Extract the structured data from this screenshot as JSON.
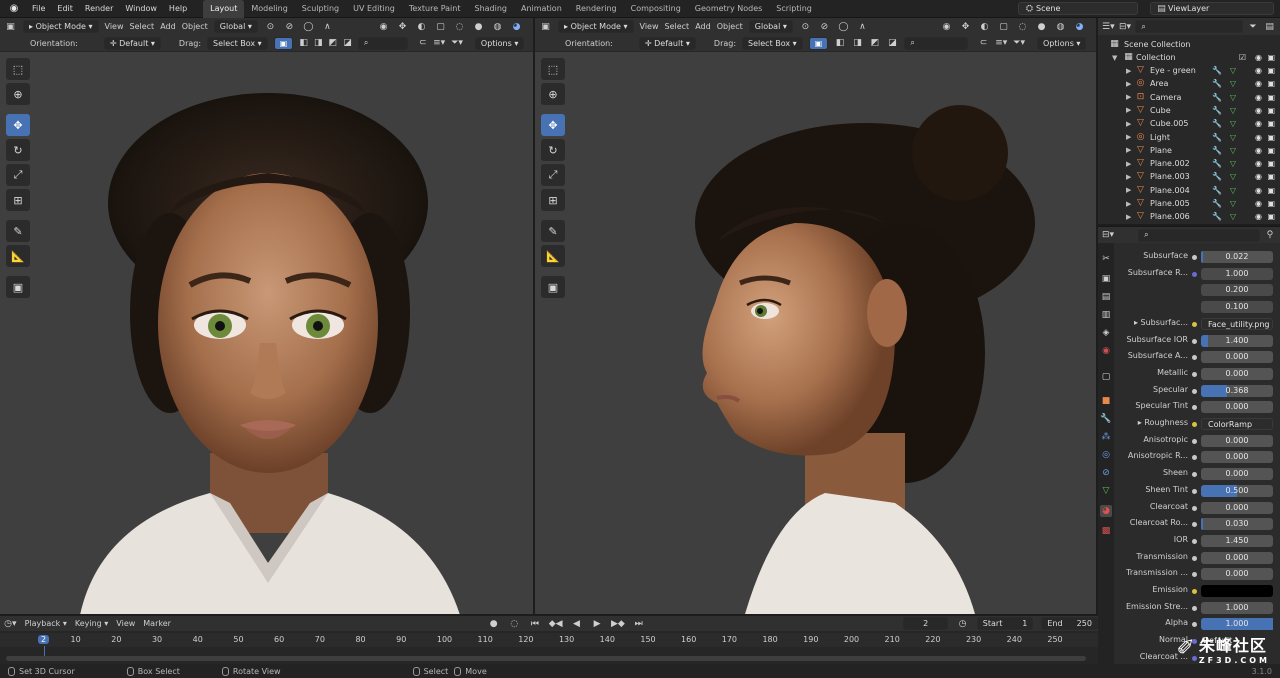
{
  "menubar": {
    "menus": [
      "File",
      "Edit",
      "Render",
      "Window",
      "Help"
    ],
    "workspaces": [
      "Layout",
      "Modeling",
      "Sculpting",
      "UV Editing",
      "Texture Paint",
      "Shading",
      "Animation",
      "Rendering",
      "Compositing",
      "Geometry Nodes",
      "Scripting"
    ],
    "active_workspace": "Layout",
    "scene": "Scene",
    "view_layer": "ViewLayer"
  },
  "viewport": {
    "mode": "Object Mode",
    "menus": [
      "View",
      "Select",
      "Add",
      "Object"
    ],
    "transform": "Global",
    "orientation_label": "Orientation:",
    "orientation_value": "Default",
    "drag_label": "Drag:",
    "drag_value": "Select Box",
    "options": "Options",
    "search_placeholder": ""
  },
  "outliner": {
    "root": "Scene Collection",
    "collection": "Collection",
    "items": [
      {
        "name": "Eye - green",
        "icon": "mesh-icon",
        "color": "#e8884a"
      },
      {
        "name": "Area",
        "icon": "light-icon",
        "color": "#e8884a"
      },
      {
        "name": "Camera",
        "icon": "camera-icon",
        "color": "#e8884a"
      },
      {
        "name": "Cube",
        "icon": "mesh-icon",
        "color": "#e8884a"
      },
      {
        "name": "Cube.005",
        "icon": "mesh-icon",
        "color": "#e8884a"
      },
      {
        "name": "Light",
        "icon": "light-icon",
        "color": "#e8884a"
      },
      {
        "name": "Plane",
        "icon": "mesh-icon",
        "color": "#e8884a"
      },
      {
        "name": "Plane.002",
        "icon": "mesh-icon",
        "color": "#e8884a"
      },
      {
        "name": "Plane.003",
        "icon": "mesh-icon",
        "color": "#e8884a"
      },
      {
        "name": "Plane.004",
        "icon": "mesh-icon",
        "color": "#e8884a"
      },
      {
        "name": "Plane.005",
        "icon": "mesh-icon",
        "color": "#e8884a"
      },
      {
        "name": "Plane.006",
        "icon": "mesh-icon",
        "color": "#e8884a"
      }
    ]
  },
  "properties": {
    "rows": [
      {
        "label": "Subsurface",
        "value": "0.022",
        "kind": "num",
        "fill": 0.022
      },
      {
        "label": "Subsurface R...",
        "value": "1.000",
        "kind": "vec"
      },
      {
        "label": "",
        "value": "0.200",
        "kind": "vec"
      },
      {
        "label": "",
        "value": "0.100",
        "kind": "vec"
      },
      {
        "label": "Subsurfac...",
        "value": "Face_utility.png",
        "kind": "tex"
      },
      {
        "label": "Subsurface IOR",
        "value": "1.400",
        "kind": "num",
        "fill": 0.1
      },
      {
        "label": "Subsurface A...",
        "value": "0.000",
        "kind": "num",
        "fill": 0
      },
      {
        "label": "Metallic",
        "value": "0.000",
        "kind": "num",
        "fill": 0
      },
      {
        "label": "Specular",
        "value": "0.368",
        "kind": "num",
        "fill": 0.368
      },
      {
        "label": "Specular Tint",
        "value": "0.000",
        "kind": "num",
        "fill": 0
      },
      {
        "label": "Roughness",
        "value": "ColorRamp",
        "kind": "tex"
      },
      {
        "label": "Anisotropic",
        "value": "0.000",
        "kind": "num",
        "fill": 0
      },
      {
        "label": "Anisotropic R...",
        "value": "0.000",
        "kind": "num",
        "fill": 0
      },
      {
        "label": "Sheen",
        "value": "0.000",
        "kind": "num",
        "fill": 0
      },
      {
        "label": "Sheen Tint",
        "value": "0.500",
        "kind": "num",
        "fill": 0.5
      },
      {
        "label": "Clearcoat",
        "value": "0.000",
        "kind": "num",
        "fill": 0
      },
      {
        "label": "Clearcoat Ro...",
        "value": "0.030",
        "kind": "num",
        "fill": 0.03
      },
      {
        "label": "IOR",
        "value": "1.450",
        "kind": "num",
        "fill": 0
      },
      {
        "label": "Transmission",
        "value": "0.000",
        "kind": "num",
        "fill": 0
      },
      {
        "label": "Transmission ...",
        "value": "0.000",
        "kind": "num",
        "fill": 0
      },
      {
        "label": "Emission",
        "value": "",
        "kind": "color"
      },
      {
        "label": "Emission Stre...",
        "value": "1.000",
        "kind": "num",
        "fill": 0
      },
      {
        "label": "Alpha",
        "value": "1.000",
        "kind": "num",
        "fill": 1
      },
      {
        "label": "Normal",
        "value": "Default",
        "kind": "link"
      },
      {
        "label": "Clearcoat ...",
        "value": "",
        "kind": "link"
      }
    ]
  },
  "timeline": {
    "menus": [
      "Playback",
      "Keying",
      "View",
      "Marker"
    ],
    "current_frame": "2",
    "start_label": "Start",
    "start": "1",
    "end_label": "End",
    "end": "250",
    "ticks": [
      "2",
      "10",
      "20",
      "30",
      "40",
      "50",
      "60",
      "70",
      "80",
      "90",
      "100",
      "110",
      "120",
      "130",
      "140",
      "150",
      "160",
      "170",
      "180",
      "190",
      "200",
      "210",
      "220",
      "230",
      "240",
      "250"
    ]
  },
  "statusbar": {
    "items": [
      "Set 3D Cursor",
      "Box Select",
      "Rotate View",
      "Select",
      "Move"
    ],
    "version": "3.1.0"
  },
  "watermark": {
    "text": "朱峰社区",
    "sub": "ZF3D.COM"
  }
}
